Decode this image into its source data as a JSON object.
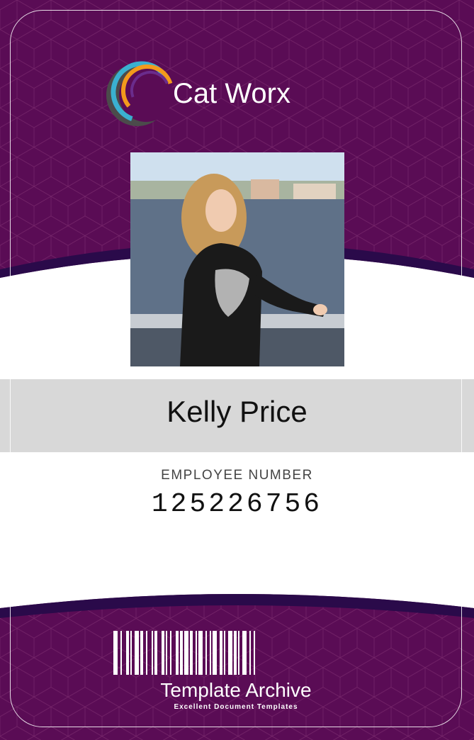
{
  "company": {
    "name": "Cat Worx"
  },
  "employee": {
    "name": "Kelly Price",
    "number_label": "EMPLOYEE NUMBER",
    "number": "125226756"
  },
  "footer": {
    "brand": "Template Archive",
    "tagline": "Excellent Document Templates"
  },
  "colors": {
    "card_purple": "#5a0c55",
    "dark_navy_band": "#2a0a4a",
    "name_band": "#d8d8d8",
    "logo_orange": "#f39a1c",
    "logo_blue": "#3ab0d0",
    "logo_purple": "#6a2c8c",
    "logo_gray": "#4b4b4b"
  },
  "icons": {
    "logo": "cat-worx-logo-icon",
    "barcode": "barcode-icon"
  }
}
